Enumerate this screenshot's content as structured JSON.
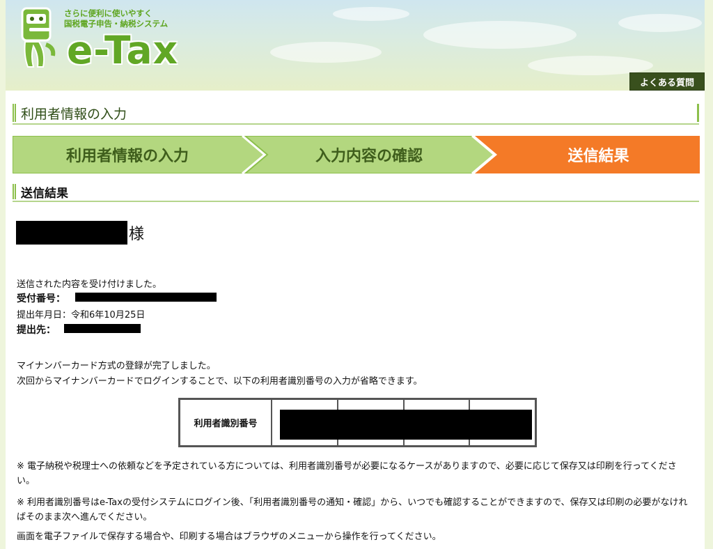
{
  "header": {
    "tagline_line1": "さらに便利に使いやすく",
    "tagline_line2": "国税電子申告・納税システム",
    "logo_text": "e-Tax",
    "faq_label": "よくある質問"
  },
  "page_title": "利用者情報の入力",
  "steps": [
    {
      "label": "利用者情報の入力",
      "state": "done"
    },
    {
      "label": "入力内容の確認",
      "state": "done"
    },
    {
      "label": "送信結果",
      "state": "current"
    }
  ],
  "section_heading": "送信結果",
  "greeting_suffix": "様",
  "result": {
    "received_message": "送信された内容を受け付けました。",
    "receipt_number_label": "受付番号：",
    "submission_date_label": "提出年月日：",
    "submission_date_value": "令和6年10月25日",
    "destination_label": "提出先："
  },
  "registration": {
    "complete_message": "マイナンバーカード方式の登録が完了しました。",
    "next_login_message": "次回からマイナンバーカードでログインすることで、以下の利用者識別番号の入力が省略できます。"
  },
  "id_table": {
    "header": "利用者識別番号"
  },
  "notes": {
    "note1": "※ 電子納税や税理士への依頼などを予定されている方については、利用者識別番号が必要になるケースがありますので、必要に応じて保存又は印刷を行ってください。",
    "note2": "※ 利用者識別番号はe-Taxの受付システムにログイン後、「利用者識別番号の通知・確認」から、いつでも確認することができますので、保存又は印刷の必要がなければそのまま次へ進んでください。",
    "footer": "画面を電子ファイルで保存する場合や、印刷する場合はブラウザのメニューから操作を行ってください。"
  },
  "colors": {
    "brand_green": "#61a725",
    "step_done": "#b3d77f",
    "step_current": "#f47a27",
    "faq_bg": "#39501d"
  }
}
